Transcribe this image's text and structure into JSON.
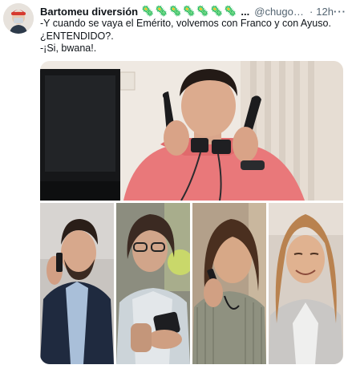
{
  "tweet": {
    "display_name": "Bartomeu diversión",
    "name_emojis": "🦠🦠🦠🦠🦠🦠🦠",
    "ellipsis": "...",
    "handle": "@chugosan...",
    "separator": "·",
    "timestamp": "12h",
    "more_icon": "more-horizontal-icon",
    "text_lines": [
      "-Y cuando se vaya el Emérito, volvemos con Franco y con Ayuso.",
      "¿ENTENDIDO?.",
      "-¡Si, bwana!."
    ]
  },
  "colors": {
    "text": "#0f1419",
    "secondary": "#536471",
    "emoji": "#3f9a2c"
  }
}
